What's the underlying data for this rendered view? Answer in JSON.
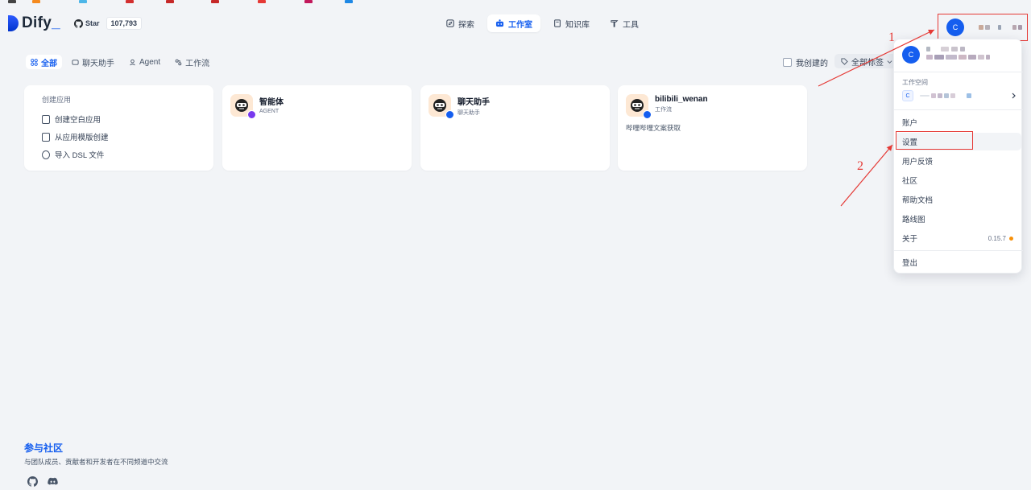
{
  "header": {
    "logo_text": "Dify",
    "github": {
      "star_label": "Star",
      "star_count": "107,793"
    },
    "nav": [
      {
        "label": "探索",
        "icon": "compass-icon"
      },
      {
        "label": "工作室",
        "icon": "robot-icon",
        "active": true
      },
      {
        "label": "知识库",
        "icon": "book-icon"
      },
      {
        "label": "工具",
        "icon": "hammer-icon"
      }
    ],
    "avatar_initial": "C"
  },
  "filters": {
    "tabs": [
      {
        "label": "全部",
        "icon": "grid-icon",
        "active": true
      },
      {
        "label": "聊天助手",
        "icon": "chat-icon"
      },
      {
        "label": "Agent",
        "icon": "agent-icon"
      },
      {
        "label": "工作流",
        "icon": "workflow-icon"
      }
    ],
    "mine_label": "我创建的",
    "tag_label": "全部标签"
  },
  "create_card": {
    "title": "创建应用",
    "items": [
      {
        "label": "创建空白应用",
        "icon": "file-plus-icon"
      },
      {
        "label": "从应用模版创建",
        "icon": "template-icon"
      },
      {
        "label": "导入 DSL 文件",
        "icon": "import-icon"
      }
    ]
  },
  "apps": [
    {
      "name": "智能体",
      "type": "AGENT",
      "desc": "",
      "badge_color": "#7839ee"
    },
    {
      "name": "聊天助手",
      "type": "聊天助手",
      "desc": "",
      "badge_color": "#155eef"
    },
    {
      "name": "bilibili_wenan",
      "type": "工作流",
      "desc": "哔哩哔哩文案获取",
      "badge_color": "#155eef"
    }
  ],
  "dropdown": {
    "avatar_initial": "C",
    "workspace_label": "工作空间",
    "workspace_initial": "C",
    "items": [
      "账户",
      "设置",
      "用户反馈",
      "社区",
      "帮助文档",
      "路线图",
      "关于"
    ],
    "version": "0.15.7",
    "logout": "登出"
  },
  "community": {
    "title": "参与社区",
    "subtitle": "与团队成员、贡献者和开发者在不同频道中交流"
  },
  "annotations": {
    "label_1": "1",
    "label_2": "2",
    "color": "#e53935"
  },
  "colors": {
    "accent": "#155eef",
    "bg": "#f2f4f7"
  }
}
